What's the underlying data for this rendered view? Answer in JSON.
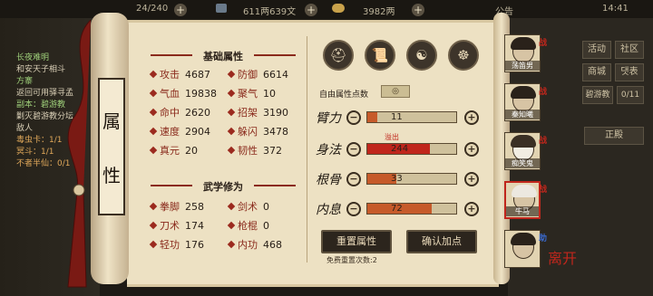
{
  "topbar": {
    "energy": "24/240",
    "copper": "611两639文",
    "silver": "3982两",
    "notice": "公告",
    "time": "14:41"
  },
  "quest_panel": {
    "lines": [
      {
        "text": "长夜难明",
        "tone": "green"
      },
      {
        "text": "和安天子相斗",
        "tone": "white"
      },
      {
        "text": "方寨",
        "tone": "green"
      },
      {
        "text": "返回可用驿寻孟",
        "tone": "white"
      },
      {
        "text": "副本：碧游教",
        "tone": "green"
      },
      {
        "text": "剿灭碧游教分坛",
        "tone": "white"
      },
      {
        "text": "敌人",
        "tone": "white"
      },
      {
        "text": "毒虫卡：1/1",
        "tone": "orange"
      },
      {
        "text": "冥斗：1/1",
        "tone": "orange"
      },
      {
        "text": "不者半仙：0/1",
        "tone": "orange"
      }
    ]
  },
  "scroll_label": [
    "属",
    "性"
  ],
  "basic_attrs": {
    "title": "基础属性",
    "items": [
      {
        "label": "攻击",
        "value": "4687"
      },
      {
        "label": "防御",
        "value": "6614"
      },
      {
        "label": "气血",
        "value": "19838"
      },
      {
        "label": "聚气",
        "value": "10"
      },
      {
        "label": "命中",
        "value": "2620"
      },
      {
        "label": "招架",
        "value": "3190"
      },
      {
        "label": "速度",
        "value": "2904"
      },
      {
        "label": "躲闪",
        "value": "3478"
      },
      {
        "label": "真元",
        "value": "20"
      },
      {
        "label": "韧性",
        "value": "372"
      }
    ]
  },
  "martial": {
    "title": "武学修为",
    "items": [
      {
        "label": "拳脚",
        "value": "258"
      },
      {
        "label": "剑术",
        "value": "0"
      },
      {
        "label": "刀术",
        "value": "174"
      },
      {
        "label": "枪棍",
        "value": "0"
      },
      {
        "label": "轻功",
        "value": "176"
      },
      {
        "label": "内功",
        "value": "468"
      }
    ]
  },
  "free_points": {
    "label": "自由属性点数",
    "value": ""
  },
  "overflow_text": "溢出",
  "attributes": [
    {
      "name": "臂力",
      "value": "11",
      "fill": 0.11,
      "red": false
    },
    {
      "name": "身法",
      "value": "244",
      "fill": 0.7,
      "red": true
    },
    {
      "name": "根骨",
      "value": "33",
      "fill": 0.33,
      "red": false
    },
    {
      "name": "内息",
      "value": "72",
      "fill": 0.72,
      "red": false
    }
  ],
  "buttons": {
    "reset": "重置属性",
    "confirm": "确认加点"
  },
  "free_reset_text": "免费重置次数:2",
  "right_menu": [
    "活动",
    "社区",
    "商城",
    "댓表",
    "碧游教",
    "0/11"
  ],
  "right_tab": "正殿",
  "portraits": [
    {
      "name": "荡笛男",
      "badge": "战"
    },
    {
      "name": "秦知曦",
      "badge": "战"
    },
    {
      "name": "痴笑鬼",
      "badge": "战"
    },
    {
      "name": "牛马",
      "badge": "战"
    },
    {
      "name": "",
      "badge": "助"
    }
  ],
  "seal_text": "离开"
}
